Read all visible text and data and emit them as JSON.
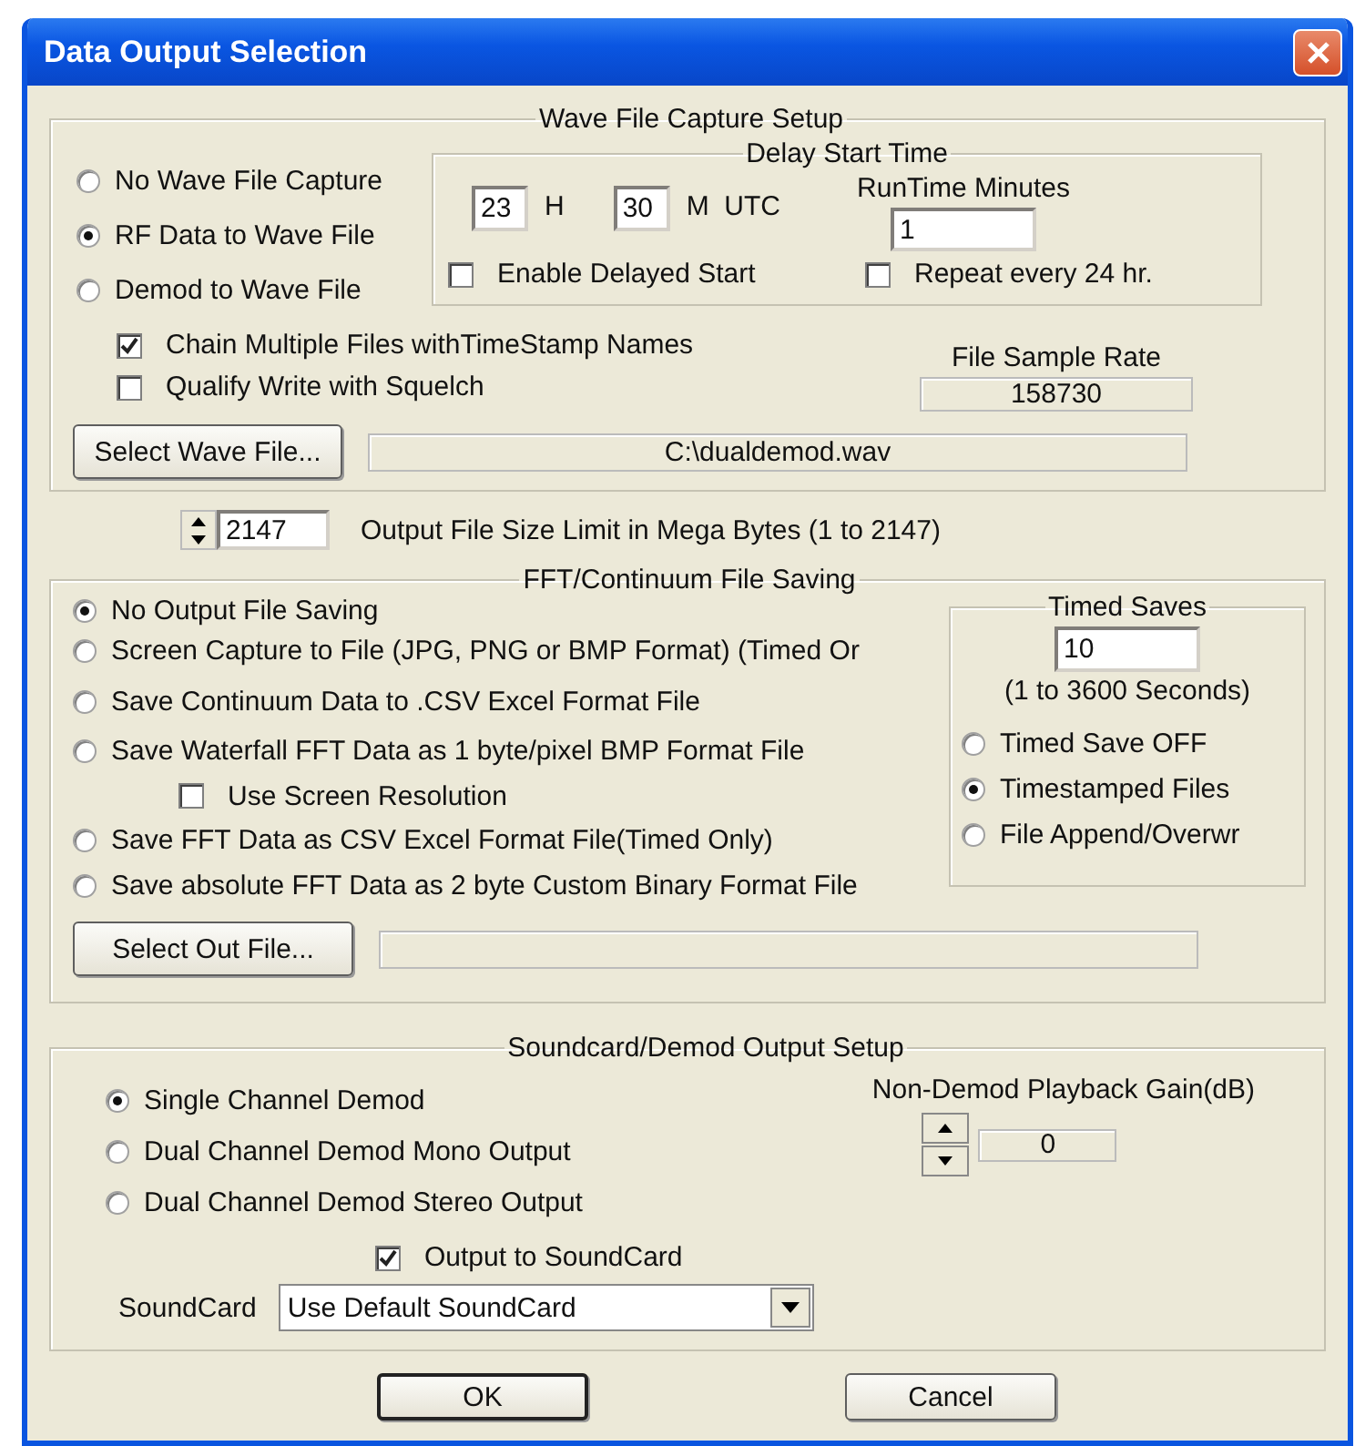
{
  "window": {
    "title": "Data Output Selection"
  },
  "wave_capture": {
    "title": "Wave File Capture Setup",
    "modes": [
      {
        "label": "No Wave File Capture",
        "selected": false
      },
      {
        "label": "RF Data to Wave File",
        "selected": true
      },
      {
        "label": "Demod to Wave File",
        "selected": false
      }
    ],
    "delay": {
      "title": "Delay Start Time",
      "hour": "23",
      "hour_unit": "H",
      "minute": "30",
      "minute_unit": "M  UTC",
      "runtime_label": "RunTime Minutes",
      "runtime": "1",
      "options": [
        {
          "label": "Enable Delayed Start",
          "checked": false
        },
        {
          "label": "Repeat every 24 hr.",
          "checked": false
        }
      ]
    },
    "options": [
      {
        "label": "Chain Multiple Files withTimeStamp Names",
        "checked": true
      },
      {
        "label": "Qualify Write with Squelch",
        "checked": false
      }
    ],
    "sample_rate": {
      "label": "File Sample Rate",
      "value": "158730"
    },
    "select_button": "Select Wave File...",
    "file_path": "C:\\dualdemod.wav"
  },
  "size_limit": {
    "value": "2147",
    "label": "Output File Size Limit in Mega Bytes (1 to 2147)"
  },
  "fft_saving": {
    "title": "FFT/Continuum File Saving",
    "options": [
      {
        "kind": "radio",
        "label": "No Output File Saving",
        "selected": true
      },
      {
        "kind": "radio",
        "label": "Screen Capture to File (JPG, PNG or BMP Format) (Timed Or",
        "selected": false
      },
      {
        "kind": "radio",
        "label": "Save Continuum Data to .CSV Excel Format File",
        "selected": false
      },
      {
        "kind": "radio",
        "label": "Save Waterfall FFT Data as 1 byte/pixel BMP Format File",
        "selected": false
      },
      {
        "kind": "checkbox",
        "label": "Use Screen Resolution",
        "checked": false
      },
      {
        "kind": "radio",
        "label": "Save FFT Data as CSV Excel  Format File(Timed Only)",
        "selected": false
      },
      {
        "kind": "radio",
        "label": "Save absolute FFT Data as 2 byte Custom Binary Format File",
        "selected": false
      }
    ],
    "timed": {
      "title": "Timed Saves",
      "value": "10",
      "range": "(1 to 3600 Seconds)",
      "modes": [
        {
          "label": "Timed Save OFF",
          "selected": false
        },
        {
          "label": "Timestamped Files",
          "selected": true
        },
        {
          "label": "File Append/Overwr",
          "selected": false
        }
      ]
    },
    "select_button": "Select Out File..."
  },
  "soundcard": {
    "title": "Soundcard/Demod Output Setup",
    "modes": [
      {
        "label": "Single Channel Demod",
        "selected": true
      },
      {
        "label": "Dual Channel Demod Mono Output",
        "selected": false
      },
      {
        "label": "Dual Channel Demod Stereo Output",
        "selected": false
      }
    ],
    "gain": {
      "label": "Non-Demod Playback Gain(dB)",
      "value": "0"
    },
    "output": {
      "label": "Output to SoundCard",
      "checked": true
    },
    "device_label": "SoundCard",
    "device": "Use Default SoundCard"
  },
  "buttons": [
    {
      "label": "OK",
      "default": true
    },
    {
      "label": "Cancel",
      "default": false
    }
  ]
}
